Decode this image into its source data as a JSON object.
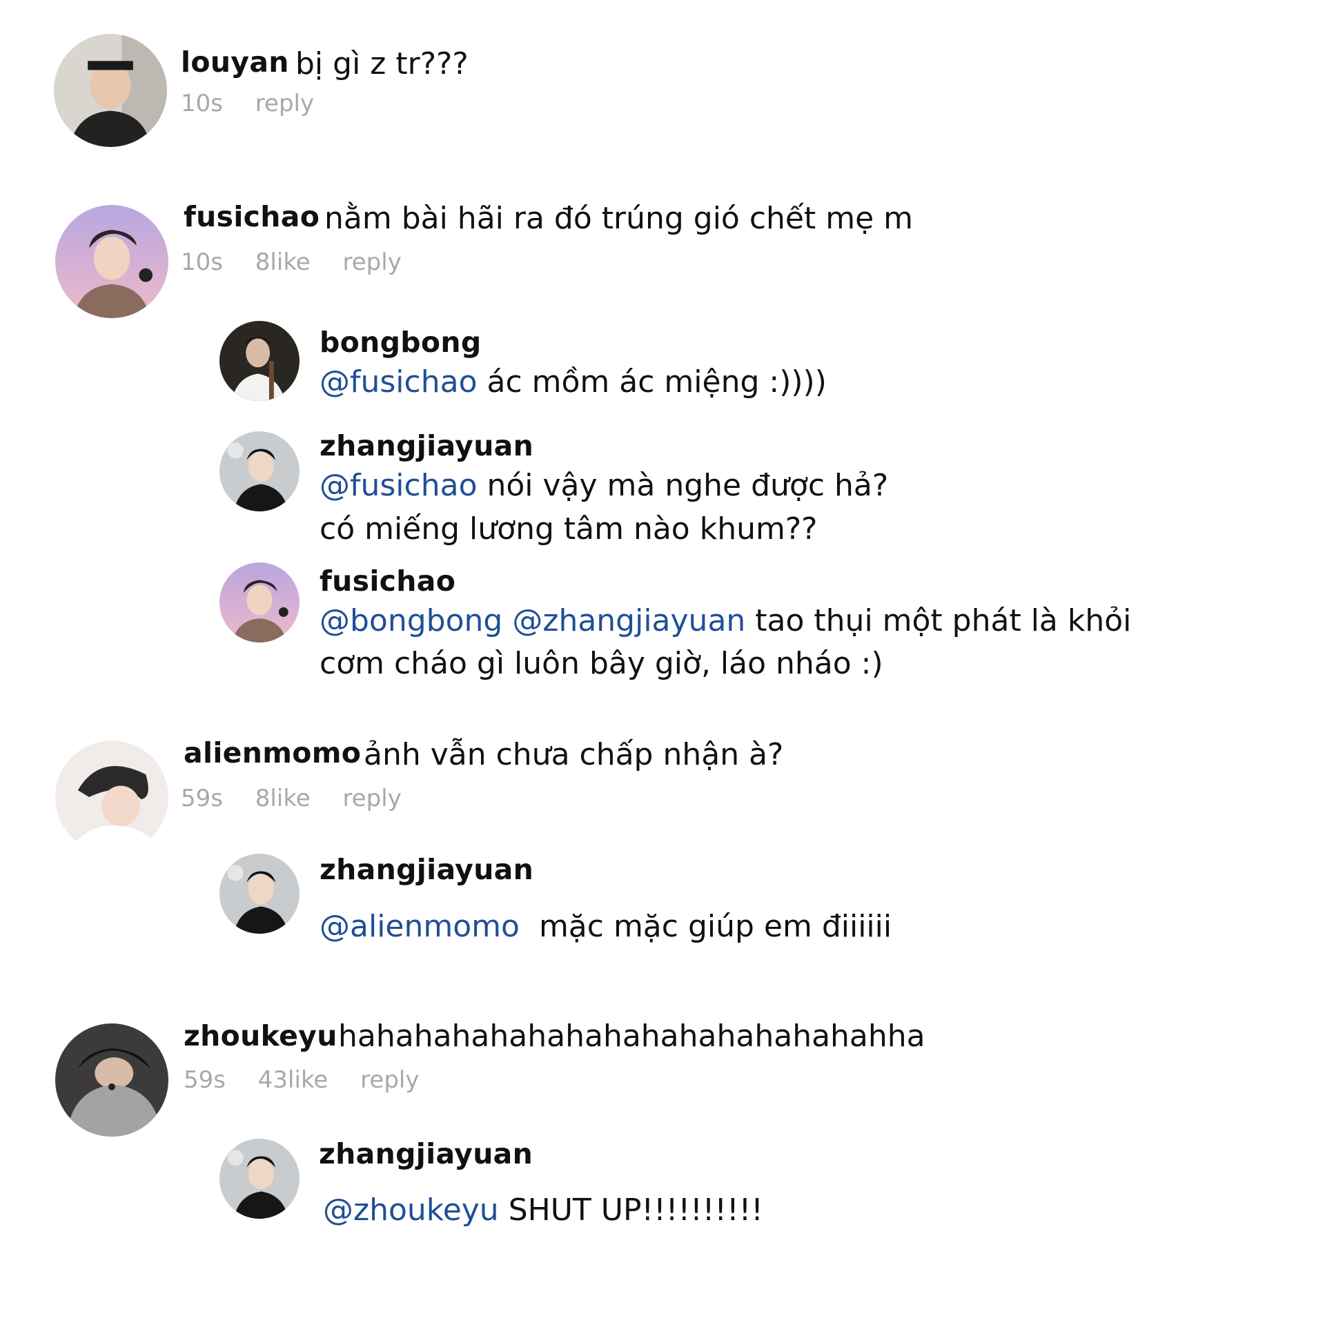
{
  "comments": [
    {
      "username": "louyan",
      "text": "bị gì z tr???",
      "time": "10s",
      "reply": "reply"
    },
    {
      "username": "fusichao",
      "text": "nằm bài hãi ra đó trúng gió chết mẹ m",
      "time": "10s",
      "likes": "8like",
      "reply": "reply",
      "replies": [
        {
          "username": "bongbong",
          "mentions": [
            "@fusichao"
          ],
          "text": "ác mồm ác miệng :))))"
        },
        {
          "username": "zhangjiayuan",
          "mentions": [
            "@fusichao"
          ],
          "text": "nói vậy mà nghe được hả?",
          "text_line2": "có miếng lương tâm nào khum??"
        },
        {
          "username": "fusichao",
          "mentions": [
            "@bongbong",
            "@zhangjiayuan"
          ],
          "text": "tao thụi một phát là khỏi",
          "text_line2": "cơm cháo gì luôn bây giờ, láo nháo :)"
        }
      ]
    },
    {
      "username": "alienmomo",
      "text": "ảnh vẫn chưa chấp nhận à?",
      "time": "59s",
      "likes": "8like",
      "reply": "reply",
      "replies": [
        {
          "username": "zhangjiayuan",
          "mentions": [
            "@alienmomo"
          ],
          "text": "mặc mặc giúp em điiiiii"
        }
      ]
    },
    {
      "username": "zhoukeyu",
      "text": "hahahahahahahahahahahahahahahha",
      "time": "59s",
      "likes": "43like",
      "reply": "reply",
      "replies": [
        {
          "username": "zhangjiayuan",
          "mentions": [
            "@zhoukeyu"
          ],
          "text": "SHUT UP!!!!!!!!!!"
        }
      ]
    }
  ],
  "colors": {
    "mention": "#1f4f96",
    "meta": "#a8a8a8",
    "text": "#111111"
  }
}
